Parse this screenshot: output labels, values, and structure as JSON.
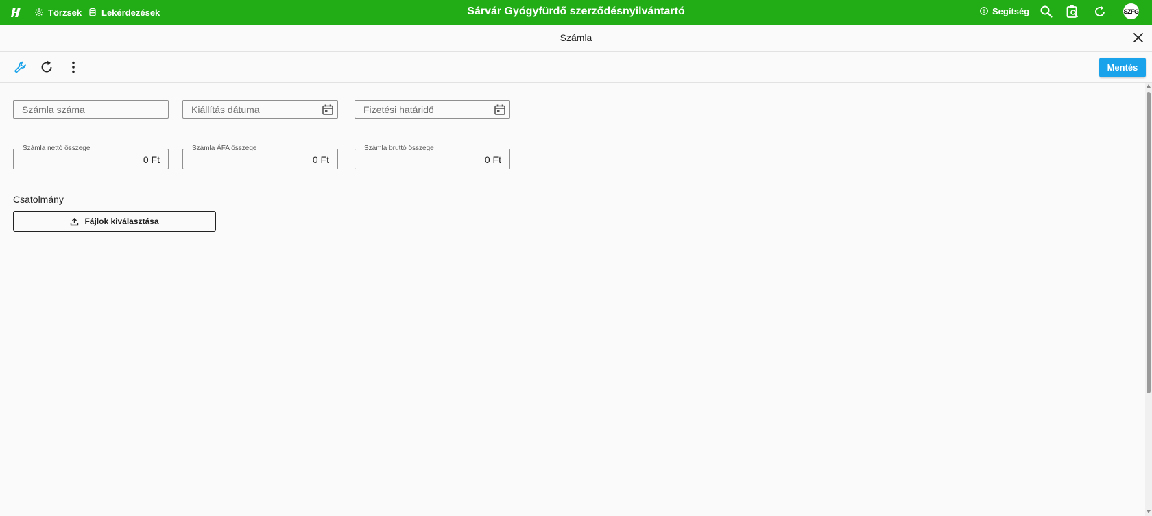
{
  "appbar": {
    "title": "Sárvár Gyógyfürdő szerződésnyilvántartó",
    "nav": [
      {
        "label": "Törzsek",
        "icon": "settings-cog-icon"
      },
      {
        "label": "Lekérdezések",
        "icon": "database-icon"
      }
    ],
    "help_label": "Segítség",
    "avatar_initials": "SZFG",
    "color": "#22ac16"
  },
  "dialog": {
    "title": "Számla"
  },
  "toolbar": {
    "save_label": "Mentés",
    "save_color": "#1aa3ea",
    "icons": [
      "wrench-icon",
      "refresh-icon",
      "more-vertical-icon"
    ]
  },
  "form": {
    "invoice_number": {
      "placeholder": "Számla száma",
      "value": ""
    },
    "issue_date": {
      "placeholder": "Kiállítás dátuma",
      "value": ""
    },
    "due_date": {
      "placeholder": "Fizetési határidő",
      "value": ""
    },
    "net_amount": {
      "label": "Számla nettó összege",
      "value": "0 Ft"
    },
    "vat_amount": {
      "label": "Számla ÁFA összege",
      "value": "0 Ft"
    },
    "gross_amount": {
      "label": "Számla bruttó összege",
      "value": "0 Ft"
    },
    "attachment_label": "Csatolmány",
    "upload_label": "Fájlok kiválasztása"
  }
}
